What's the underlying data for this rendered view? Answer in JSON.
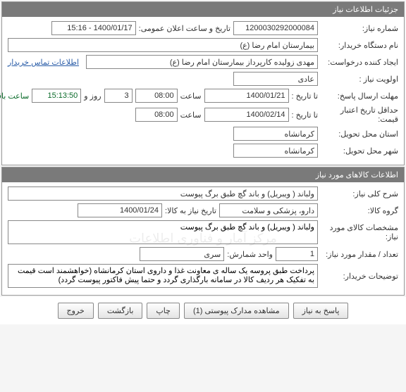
{
  "section1": {
    "title": "جزئیات اطلاعات نیاز",
    "need_number_label": "شماره نیاز:",
    "need_number": "1200030292000084",
    "announce_label": "تاریخ و ساعت اعلان عمومی:",
    "announce_value": "1400/01/17 - 15:16",
    "buyer_label": "نام دستگاه خریدار:",
    "buyer_value": "بیمارستان امام رضا (ع)",
    "requester_label": "ایجاد کننده درخواست:",
    "requester_value": "مهدی زولیده کارپرداز بیمارستان امام رضا (ع)",
    "contact_link": "اطلاعات تماس خریدار",
    "priority_label": "اولویت نیاز :",
    "priority_value": "عادی",
    "deadline_label": "مهلت ارسال پاسخ:",
    "to_date_label": "  تا تاریخ :",
    "deadline_date": "1400/01/21",
    "time_label": "ساعت",
    "deadline_time": "08:00",
    "days_value": "3",
    "days_label": "روز و",
    "remaining_time": "15:13:50",
    "remaining_label": "ساعت باقی مانده",
    "validity_label": "حداقل تاریخ اعتبار قیمت:",
    "validity_date": "1400/02/14",
    "validity_time": "08:00",
    "province_label": "استان محل تحویل:",
    "province_value": "کرمانشاه",
    "city_label": "شهر محل تحویل:",
    "city_value": "کرمانشاه"
  },
  "section2": {
    "title": "اطلاعات کالاهای مورد نیاز",
    "desc_label": "شرح کلی نیاز:",
    "desc_value": "ولباند ( ویبریل) و باند گچ طبق برگ پیوست",
    "group_label": "گروه کالا:",
    "group_value": "دارو، پزشکی و سلامت",
    "need_date_label": "تاریخ نیاز به کالا:",
    "need_date_value": "1400/01/24",
    "spec_label": "مشخصات کالای مورد نیاز:",
    "spec_value": "ولباند ( ویبریل) و باند گچ طبق برگ پیوست",
    "watermark": "مرکز آمار و فناوری اطلاعات",
    "qty_label": "تعداد / مقدار مورد نیاز:",
    "qty_value": "1",
    "unit_label": "واحد شمارش:",
    "unit_value": "سری",
    "notes_label": "توضیحات خریدار:",
    "notes_value": "پرداخت طبق پروسه یک ساله ی معاونت غذا و داروی استان کرمانشاه (خواهشمند است قیمت به تفکیک هر ردیف کالا در سامانه بارگذاری گردد و حتما پیش فاکتور پیوست گردد)"
  },
  "buttons": {
    "reply": "پاسخ به نیاز",
    "attachments": "مشاهده مدارک پیوستی  (1)",
    "print": "چاپ",
    "back": "بازگشت",
    "exit": "خروج"
  }
}
